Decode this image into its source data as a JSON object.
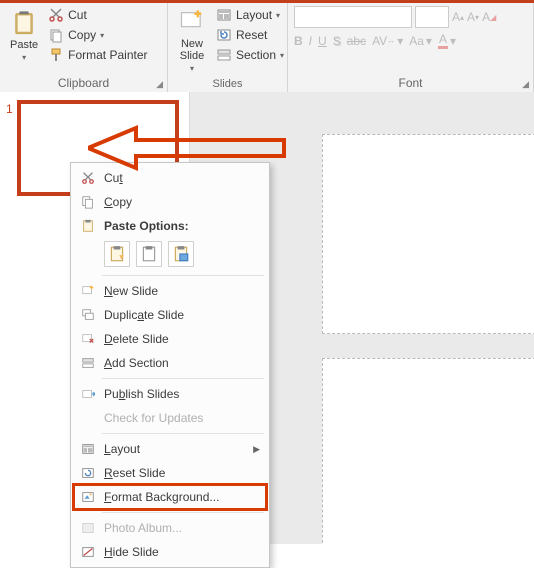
{
  "ribbon": {
    "clipboard": {
      "paste": "Paste",
      "cut": "Cut",
      "copy": "Copy",
      "format_painter": "Format Painter",
      "label": "Clipboard"
    },
    "slides": {
      "new_slide": "New\nSlide",
      "layout": "Layout",
      "reset": "Reset",
      "section": "Section",
      "label": "Slides"
    },
    "font": {
      "font_name": "",
      "font_size": "",
      "bold": "B",
      "italic": "I",
      "underline": "U",
      "shadow": "S",
      "strike": "abc",
      "spacing": "AV",
      "case": "Aa",
      "clear": "A",
      "label": "Font"
    }
  },
  "thumb": {
    "num": "1"
  },
  "ctx": {
    "cut": "Cut",
    "copy": "Copy",
    "paste_options": "Paste Options:",
    "new_slide": "New Slide",
    "duplicate_slide": "Duplicate Slide",
    "delete_slide": "Delete Slide",
    "add_section": "Add Section",
    "publish_slides": "Publish Slides",
    "check_updates": "Check for Updates",
    "layout": "Layout",
    "reset_slide": "Reset Slide",
    "format_background": "Format Background...",
    "photo_album": "Photo Album...",
    "hide_slide": "Hide Slide"
  }
}
